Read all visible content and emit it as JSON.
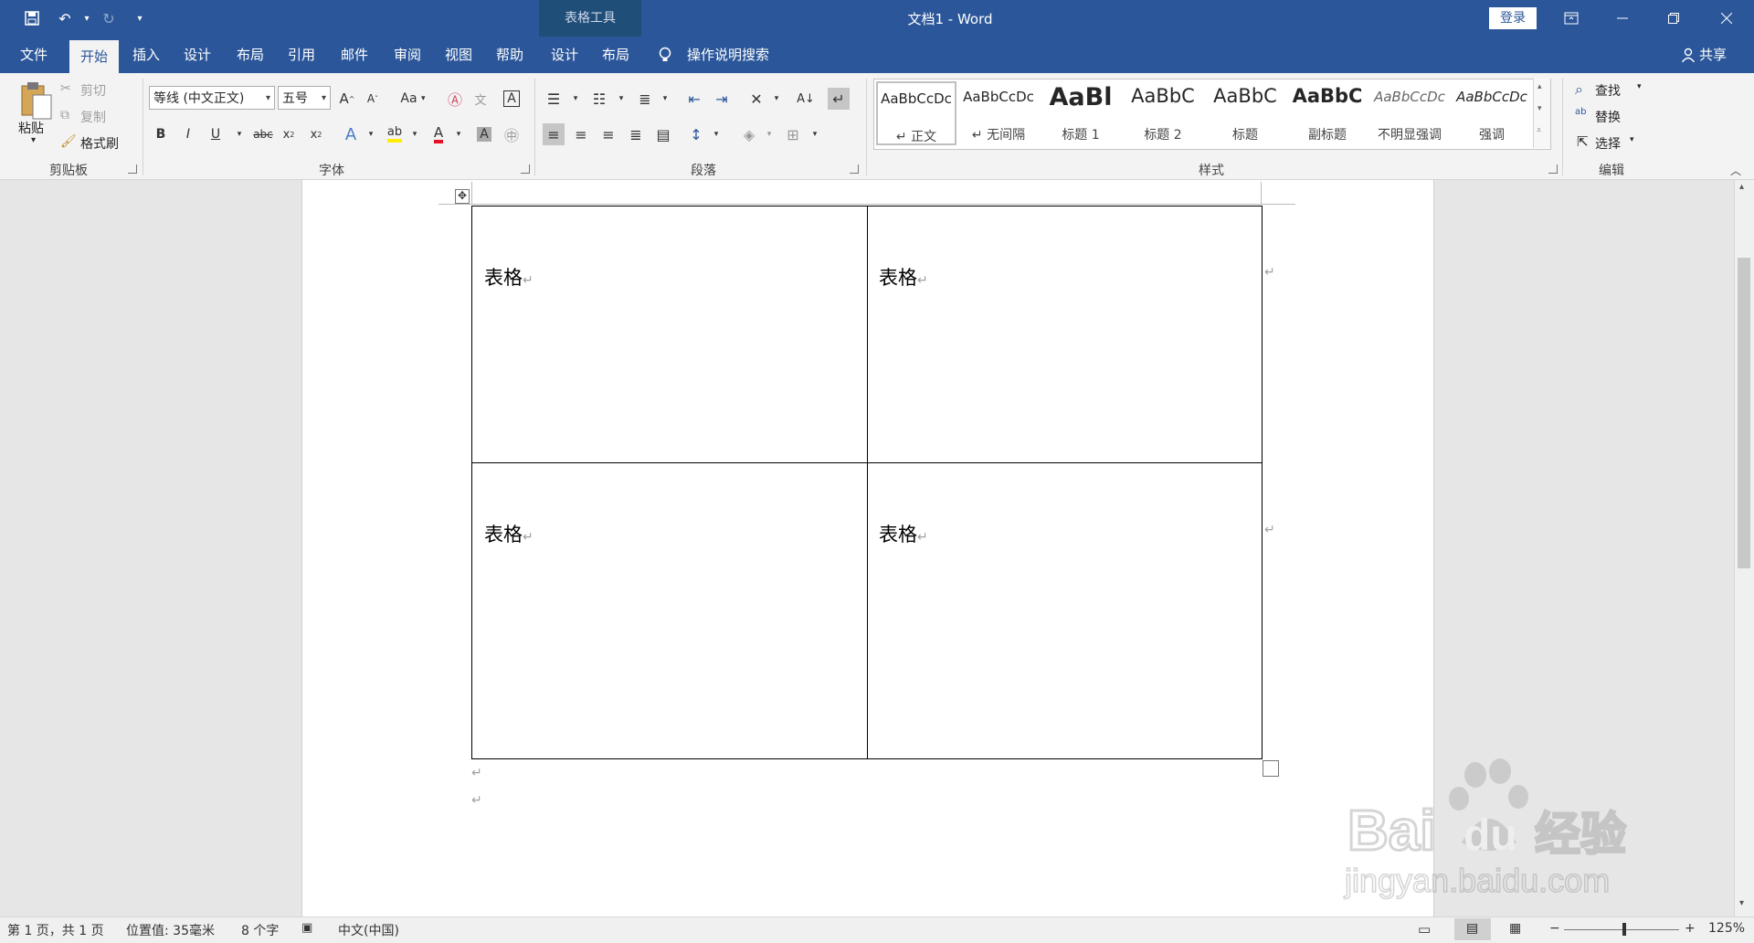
{
  "titlebar": {
    "contextual_tool": "表格工具",
    "doc_title": "文档1  -  Word",
    "login": "登录"
  },
  "tabs": {
    "file": "文件",
    "home": "开始",
    "insert": "插入",
    "design": "设计",
    "layout": "布局",
    "references": "引用",
    "mailings": "邮件",
    "review": "审阅",
    "view": "视图",
    "help": "帮助",
    "table_design": "设计",
    "table_layout": "布局",
    "tell_me": "操作说明搜索",
    "share": "共享"
  },
  "clipboard": {
    "paste": "粘贴",
    "cut": "剪切",
    "copy": "复制",
    "format_painter": "格式刷",
    "group": "剪贴板"
  },
  "font": {
    "name": "等线 (中文正文)",
    "size": "五号",
    "group": "字体",
    "bold": "B",
    "italic": "I",
    "underline": "U",
    "strike": "abc",
    "grow": "A",
    "shrink": "A",
    "case": "Aa"
  },
  "paragraph": {
    "group": "段落"
  },
  "styles": {
    "group": "样式",
    "items": [
      {
        "preview": "AaBbCcDc",
        "name": "↵ 正文"
      },
      {
        "preview": "AaBbCcDc",
        "name": "↵ 无间隔"
      },
      {
        "preview": "AaBl",
        "name": "标题 1"
      },
      {
        "preview": "AaBbC",
        "name": "标题 2"
      },
      {
        "preview": "AaBbC",
        "name": "标题"
      },
      {
        "preview": "AaBbC",
        "name": "副标题"
      },
      {
        "preview": "AaBbCcDc",
        "name": "不明显强调"
      },
      {
        "preview": "AaBbCcDc",
        "name": "强调"
      }
    ]
  },
  "editing": {
    "find": "查找",
    "replace": "替换",
    "select": "选择",
    "group": "编辑"
  },
  "table": {
    "cells": [
      "表格",
      "表格",
      "表格",
      "表格"
    ]
  },
  "statusbar": {
    "page": "第 1 页，共 1 页",
    "position": "位置值: 35毫米",
    "words": "8 个字",
    "language": "中文(中国)",
    "zoom": "125%"
  },
  "watermark": {
    "brand": "Bai",
    "brand2": "du",
    "cn": "经验",
    "url": "jingyan.baidu.com"
  }
}
